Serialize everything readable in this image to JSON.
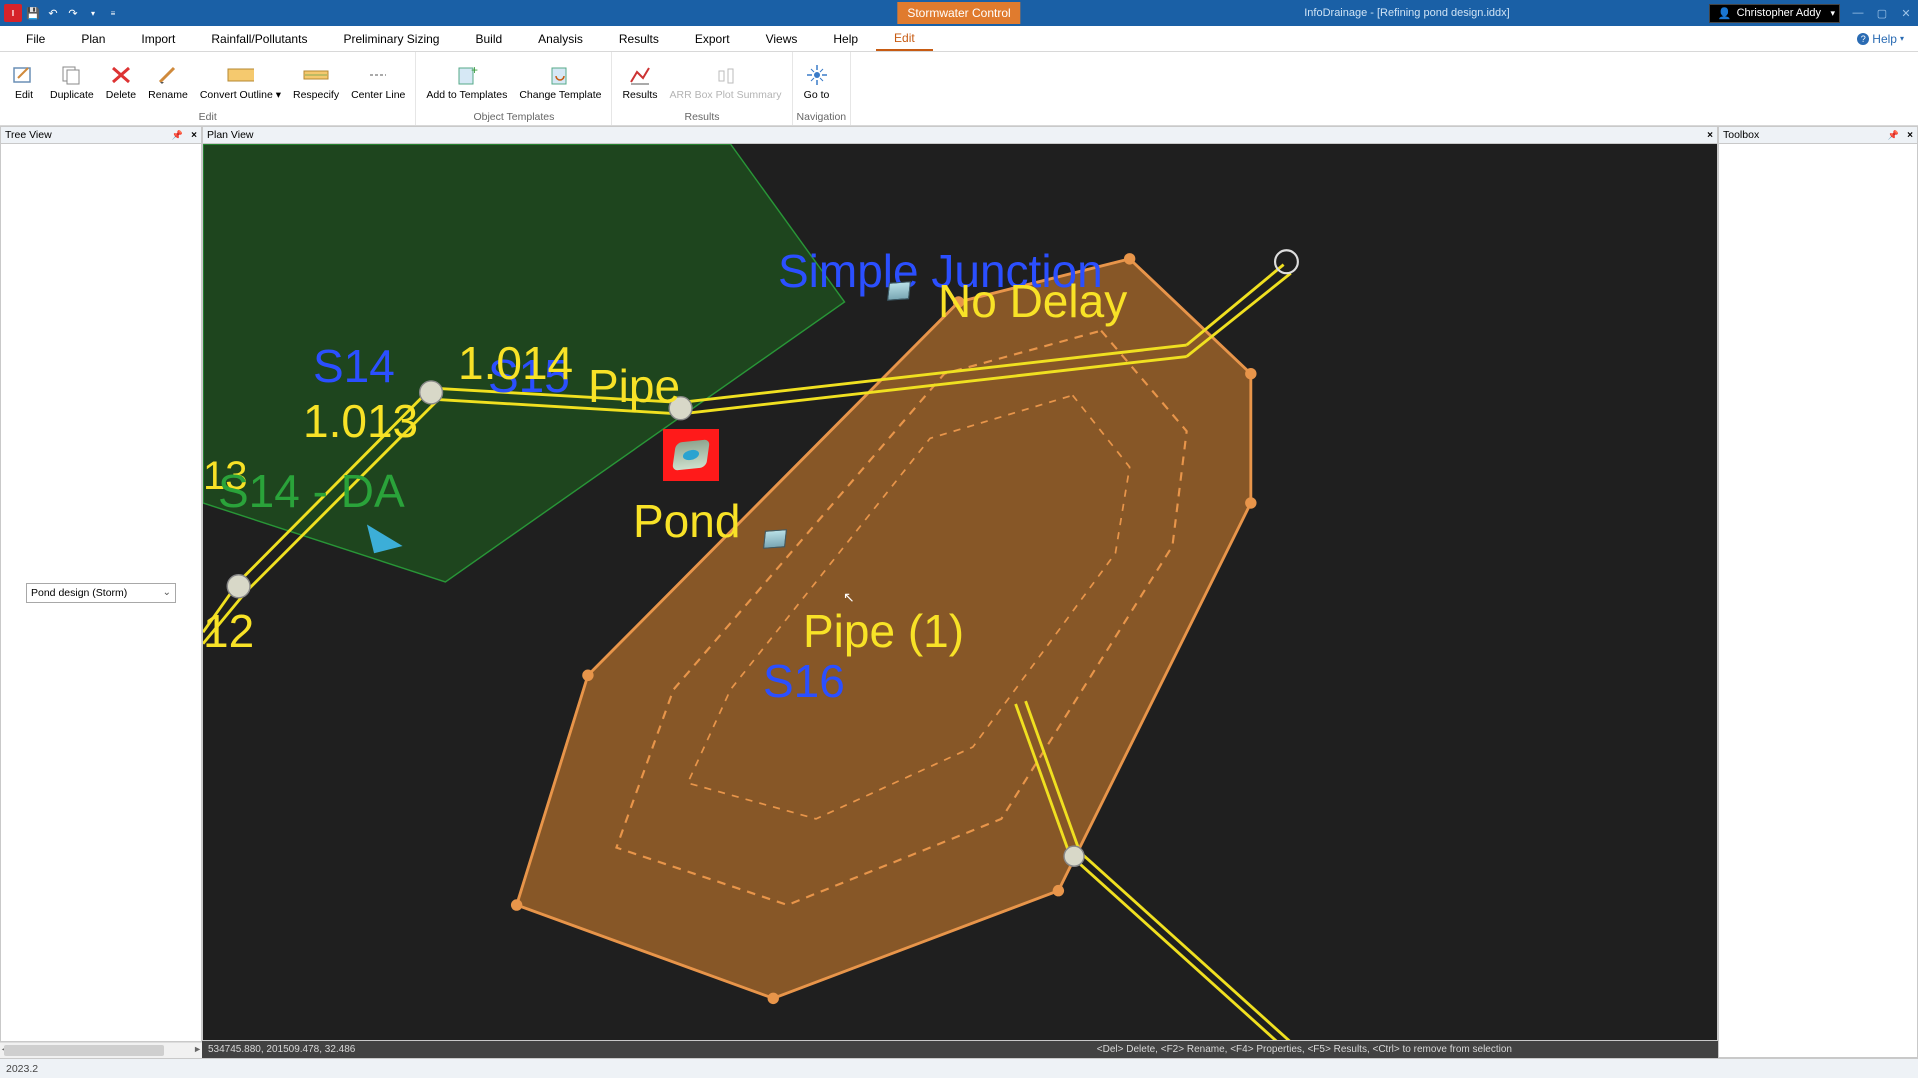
{
  "titlebar": {
    "app_badge": "I",
    "center_badge": "Stormwater Control",
    "doc_title": "InfoDrainage - [Refining pond design.iddx]",
    "user_name": "Christopher Addy"
  },
  "menu": {
    "items": [
      "File",
      "Plan",
      "Import",
      "Rainfall/Pollutants",
      "Preliminary Sizing",
      "Build",
      "Analysis",
      "Results",
      "Export",
      "Views",
      "Help",
      "Edit"
    ],
    "active_index": 11,
    "help_label": "Help"
  },
  "ribbon": {
    "groups": [
      {
        "label": "Edit",
        "buttons": [
          {
            "label": "Edit",
            "icon": "pencil-square"
          },
          {
            "label": "Duplicate",
            "icon": "copy"
          },
          {
            "label": "Delete",
            "icon": "x-red"
          },
          {
            "label": "Rename",
            "icon": "pencil"
          },
          {
            "label": "Convert Outline ▾",
            "icon": "rect-outline"
          },
          {
            "label": "Respecify",
            "icon": "arrows"
          },
          {
            "label": "Center Line",
            "icon": "center-line"
          }
        ]
      },
      {
        "label": "Object Templates",
        "buttons": [
          {
            "label": "Add to Templates",
            "icon": "plus-template"
          },
          {
            "label": "Change Template",
            "icon": "swap-template"
          }
        ]
      },
      {
        "label": "Results",
        "buttons": [
          {
            "label": "Results",
            "icon": "chart"
          },
          {
            "label": "ARR Box Plot Summary",
            "icon": "boxplot",
            "disabled": true
          }
        ]
      },
      {
        "label": "Navigation",
        "buttons": [
          {
            "label": "Go to",
            "icon": "crosshair"
          }
        ]
      }
    ]
  },
  "panels": {
    "tree_title": "Tree View",
    "plan_title": "Plan View",
    "toolbox_title": "Toolbox",
    "tree_combo_value": "Pond design (Storm)"
  },
  "canvas": {
    "labels": {
      "s14": "S14",
      "s15": "S15",
      "s16": "S16",
      "simple_junction": "Simple Junction",
      "l1013": "1.013",
      "l1014": "1.014",
      "l313": "13",
      "l12": "12",
      "pipe": "Pipe",
      "pipe1": "Pipe (1)",
      "no_delay": "No Delay",
      "pond": "Pond",
      "s14da": "S14 - DA"
    },
    "status_coords": "534745.880, 201509.478, 32.486",
    "status_hints": "<Del> Delete, <F2> Rename, <F4> Properties, <F5> Results, <Ctrl> to remove from selection"
  },
  "app_status": {
    "version": "2023.2"
  }
}
